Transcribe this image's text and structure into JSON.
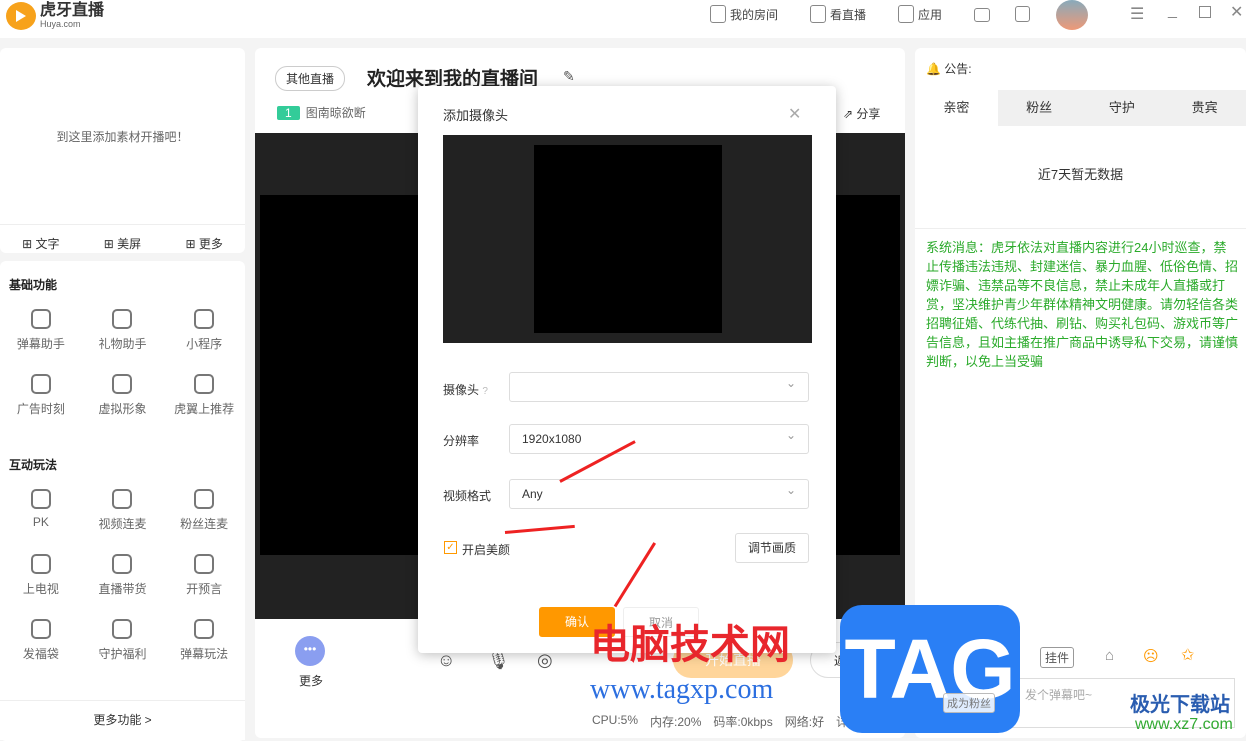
{
  "app": {
    "name": "虎牙直播",
    "domain": "Huya.com"
  },
  "topnav": [
    {
      "label": "我的房间",
      "icon": "home-icon"
    },
    {
      "label": "看直播",
      "icon": "play-icon"
    },
    {
      "label": "应用",
      "icon": "apps-icon"
    }
  ],
  "left": {
    "hint": "到这里添加素材开播吧！",
    "tools": [
      "文字",
      "美屏",
      "更多"
    ],
    "sections": [
      {
        "title": "基础功能",
        "items": [
          "弹幕助手",
          "礼物助手",
          "小程序",
          "广告时刻",
          "虚拟形象",
          "虎翼上推荐"
        ]
      },
      {
        "title": "互动玩法",
        "items": [
          "PK",
          "视频连麦",
          "粉丝连麦",
          "上电视",
          "直播带货",
          "开预言",
          "发福袋",
          "守护福利",
          "弹幕玩法"
        ]
      }
    ],
    "more": "更多功能 >"
  },
  "center": {
    "category": "其他直播",
    "title": "欢迎来到我的直播间",
    "level": "1",
    "username": "图南晾欲断",
    "share": "分享",
    "more": "更多",
    "start": "开始直播",
    "back": "返回",
    "status": {
      "cpu": "CPU:5%",
      "mem": "内存:20%",
      "rate": "码率:0kbps",
      "net": "网络:好",
      "detail": "详情 >"
    }
  },
  "right": {
    "notice": "公告:",
    "tabs": [
      "亲密",
      "粉丝",
      "守护",
      "贵宾"
    ],
    "nodata": "近7天暂无数据",
    "system": "系统消息：虎牙依法对直播内容进行24小时巡查，禁止传播违法违规、封建迷信、暴力血腥、低俗色情、招嫖诈骗、违禁品等不良信息，禁止未成年人直播或打赏，坚决维护青少年群体精神文明健康。请勿轻信各类招聘征婚、代练代抽、刷钻、购买礼包码、游戏币等广告信息，且如主播在推广商品中诱导私下交易，请谨慎判断，以免上当受骗",
    "plugin": "挂件",
    "fan": "成为粉丝",
    "placeholder": "发个弹幕吧~"
  },
  "dialog": {
    "title": "添加摄像头",
    "camera_label": "摄像头",
    "camera_value": "",
    "resolution_label": "分辨率",
    "resolution_value": "1920x1080",
    "format_label": "视频格式",
    "format_value": "Any",
    "beauty_label": "开启美颜",
    "beauty_checked": true,
    "adjust": "调节画质",
    "confirm": "确认",
    "cancel": "取消"
  },
  "watermarks": {
    "w1": "电脑技术网",
    "w2": "www.tagxp.com",
    "w3": "TAG",
    "w4": "极光下载站",
    "w5": "www.xz7.com"
  },
  "colors": {
    "accent": "#ff9800",
    "system_text": "#2aaa2a",
    "arrow": "#e22222"
  }
}
